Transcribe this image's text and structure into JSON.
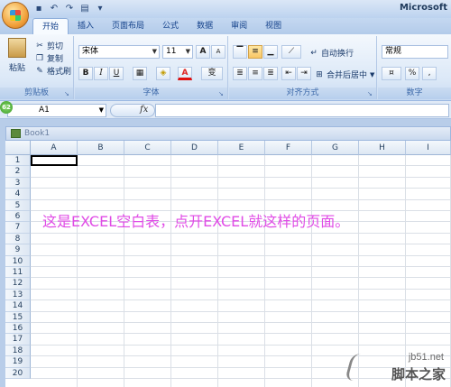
{
  "window": {
    "title": "Microsoft"
  },
  "tabs": [
    "开始",
    "插入",
    "页面布局",
    "公式",
    "数据",
    "审阅",
    "视图"
  ],
  "clipboard": {
    "paste": "粘贴",
    "cut": "剪切",
    "copy": "复制",
    "format_painter": "格式刷",
    "label": "剪贴板"
  },
  "font": {
    "name": "宋体",
    "size": "11",
    "grow": "A",
    "shrink": "A",
    "bold": "B",
    "italic": "I",
    "underline": "U",
    "color_glyph": "A",
    "phonetic": "变",
    "label": "字体"
  },
  "alignment": {
    "wrap": "自动换行",
    "merge": "合并后居中",
    "label": "对齐方式"
  },
  "number": {
    "format": "常规",
    "percent": "%",
    "comma": ",",
    "label": "数字"
  },
  "badge": "62",
  "formula_bar": {
    "cell_ref": "A1",
    "fx": "fx",
    "value": ""
  },
  "workbook": {
    "title": "Book1"
  },
  "columns": [
    "A",
    "B",
    "C",
    "D",
    "E",
    "F",
    "G",
    "H",
    "I"
  ],
  "rows": [
    "1",
    "2",
    "3",
    "4",
    "5",
    "6",
    "7",
    "8",
    "9",
    "10",
    "11",
    "12",
    "13",
    "14",
    "15",
    "16",
    "17",
    "18",
    "19",
    "20"
  ],
  "annotation": "这是EXCEL空白表，点开EXCEL就这样的页面。",
  "watermark": {
    "site": "jb51.net",
    "brand": "脚本之家"
  },
  "colors": {
    "accent": "#15428b",
    "annotation": "#e04be6"
  }
}
